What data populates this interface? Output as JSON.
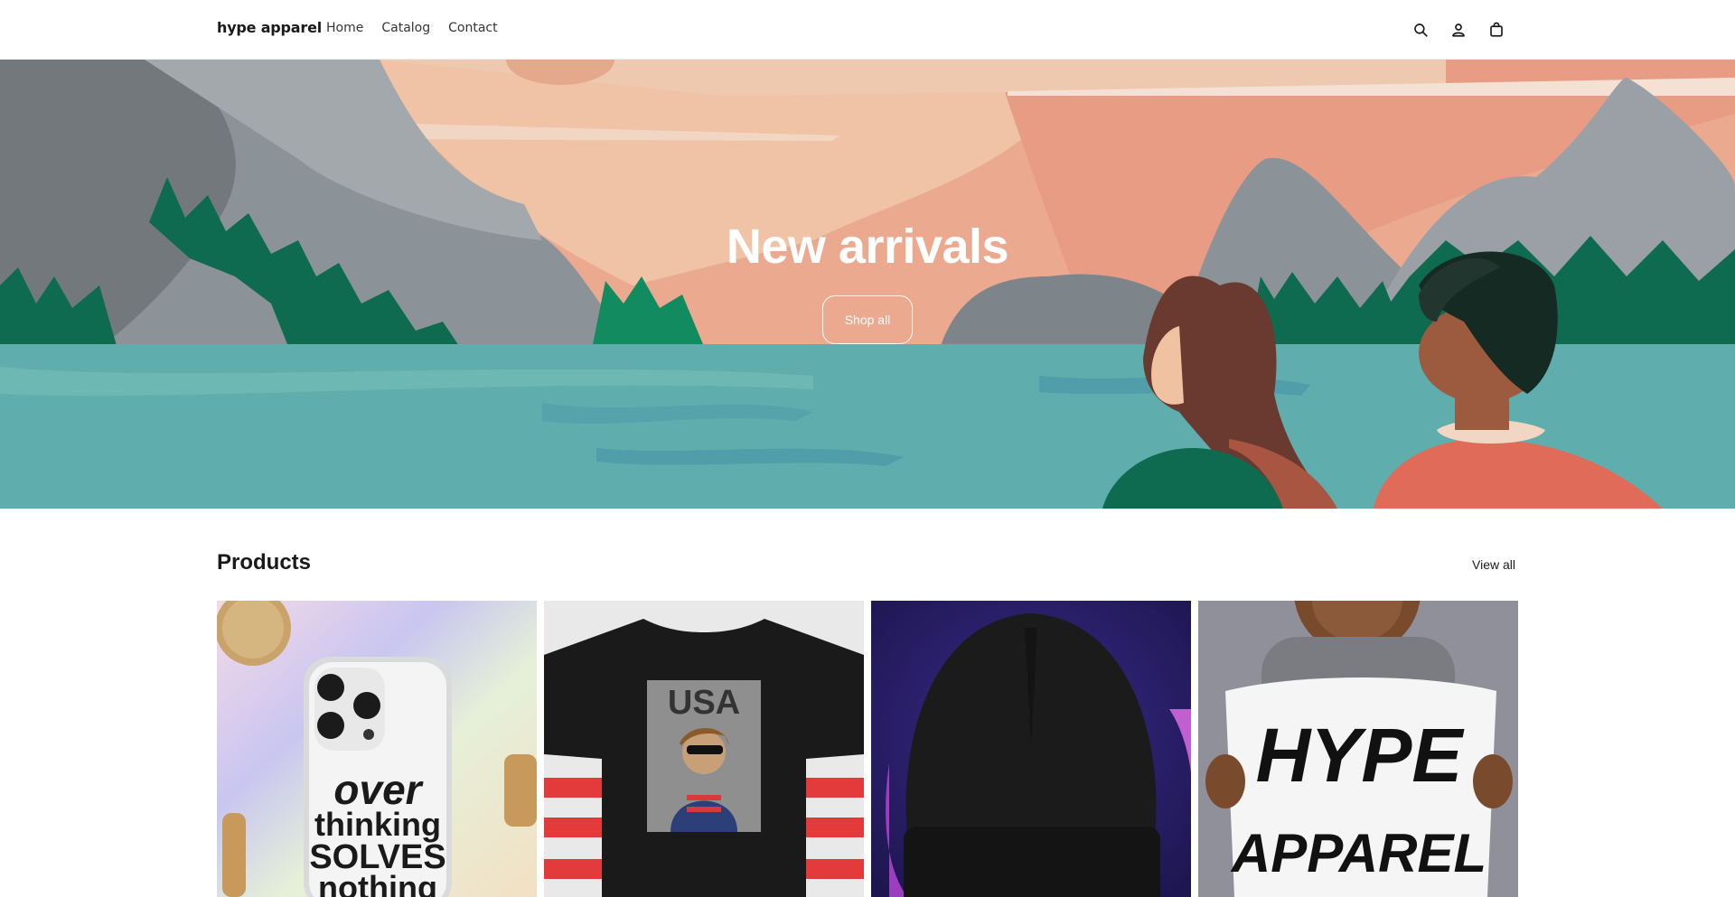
{
  "header": {
    "brand": "hype apparel",
    "nav": [
      "Home",
      "Catalog",
      "Contact"
    ],
    "icons": [
      "search-icon",
      "account-icon",
      "cart-icon"
    ]
  },
  "hero": {
    "title": "New arrivals",
    "button_label": "Shop all"
  },
  "products": {
    "title": "Products",
    "view_all": "View all",
    "items": [
      {
        "image": "phone-case-overthinking",
        "print": [
          "over",
          "thinking",
          "SOLVES",
          "nothing"
        ]
      },
      {
        "image": "black-tshirt-usa",
        "print": [
          "USA"
        ]
      },
      {
        "image": "black-beanie"
      },
      {
        "image": "hype-apparel-pillow",
        "print": [
          "HYPE",
          "APPAREL"
        ]
      }
    ]
  },
  "colors": {
    "accent": "#1a1a1a",
    "sky": "#eba98f",
    "water": "#5fadad",
    "forest": "#0e6b4f"
  }
}
